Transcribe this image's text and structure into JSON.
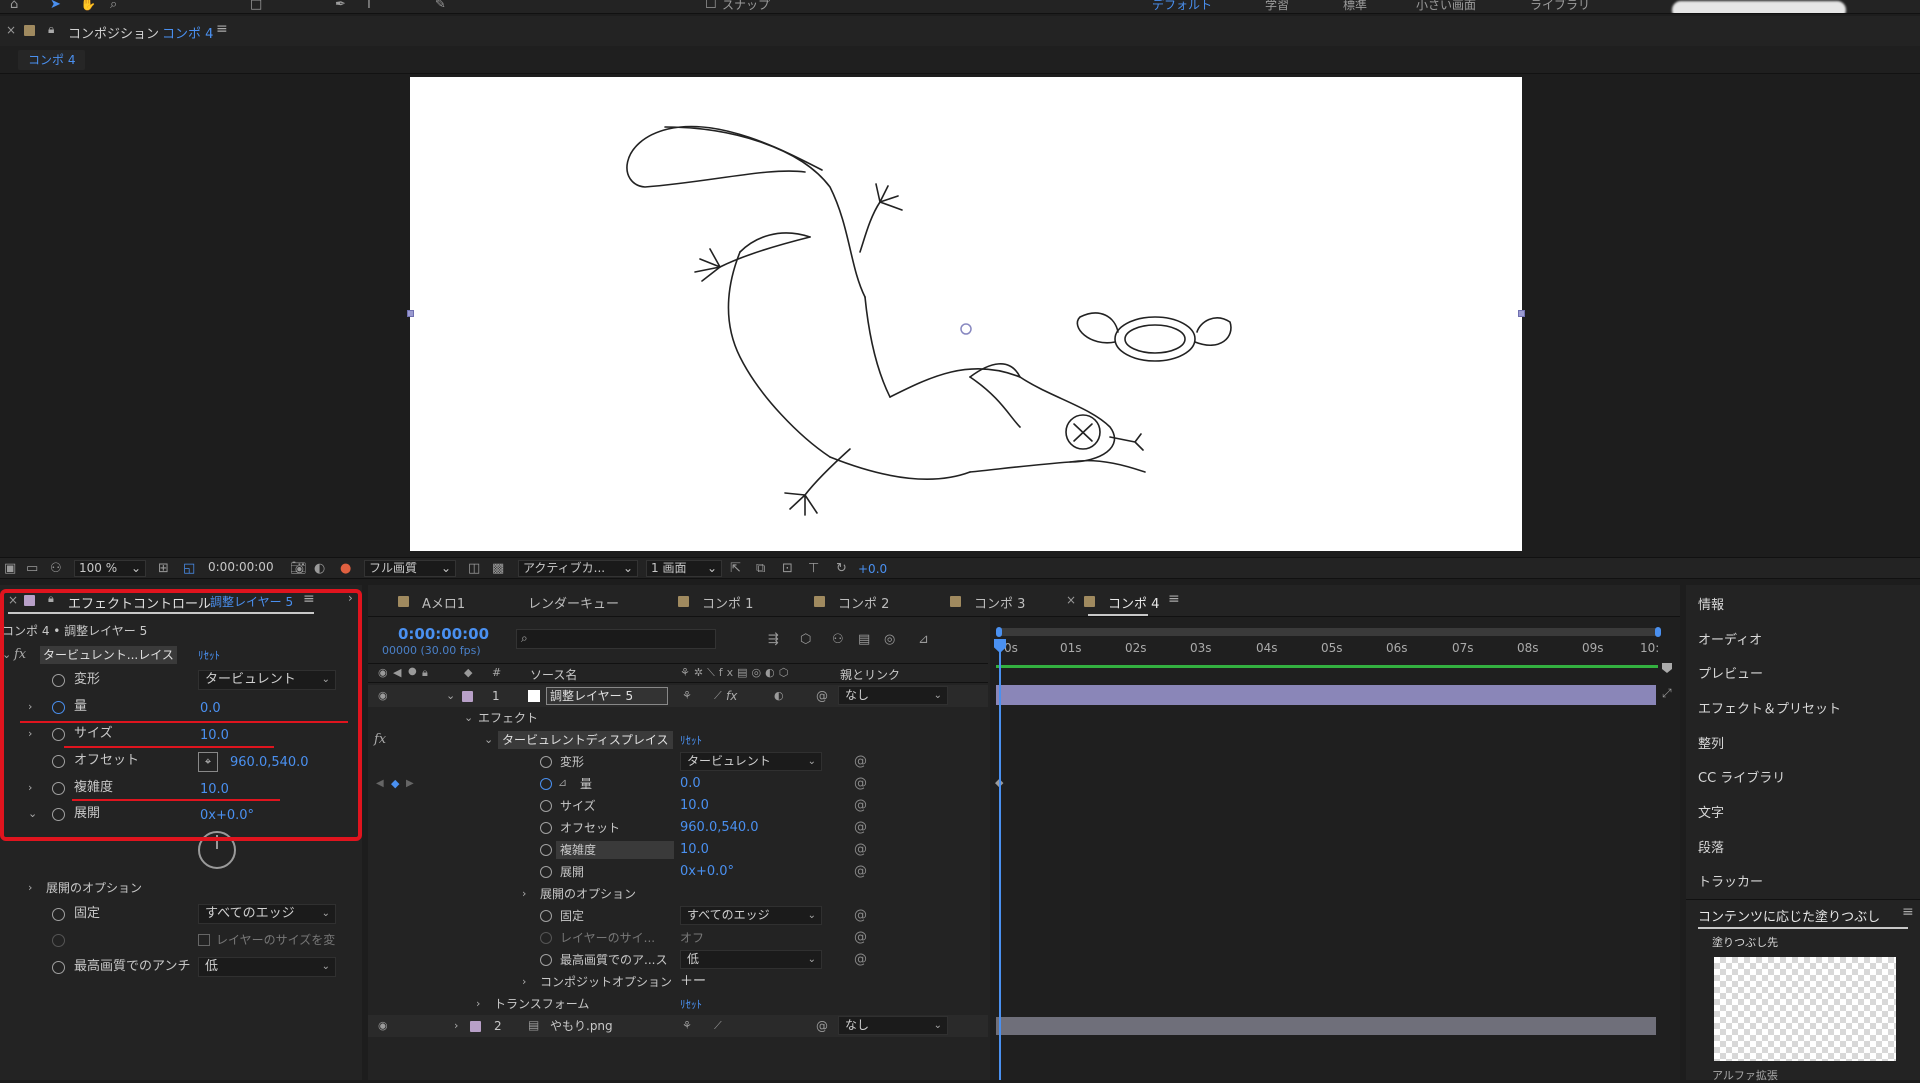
{
  "topbar": {
    "snap_label": "スナップ",
    "workspaces": [
      "デフォルト",
      "学習",
      "標準",
      "小さい画面",
      "ライブラリ"
    ],
    "active_workspace": "デフォルト"
  },
  "comp_panel": {
    "title": "コンポジション",
    "comp_name": "コンポ 4",
    "tab_label": "コンポ 4"
  },
  "viewer_toolbar": {
    "zoom": "100 %",
    "timecode": "0:00:00:00",
    "quality": "フル画質",
    "camera": "アクティブカ...",
    "views": "1 画面",
    "exposure": "+0.0"
  },
  "effect_controls": {
    "panel_title": "エフェクトコントロール",
    "layer_name": "調整レイヤー 5",
    "breadcrumb": "コンポ 4 • 調整レイヤー 5",
    "fx_label": "fx",
    "effect_name": "タービュレント...レイス",
    "reset_label": "ﾘｾｯﾄ",
    "props": {
      "displacement_label": "変形",
      "displacement_value": "タービュレント",
      "amount_label": "量",
      "amount_value": "0.0",
      "size_label": "サイズ",
      "size_value": "10.0",
      "offset_label": "オフセット",
      "offset_value": "960.0,540.0",
      "complexity_label": "複雑度",
      "complexity_value": "10.0",
      "evolution_label": "展開",
      "evolution_value": "0x+0.0°",
      "evolution_options_label": "展開のオプション",
      "pinning_label": "固定",
      "pinning_value": "すべてのエッジ",
      "resize_label": "レイヤーのサイズを変",
      "antialias_label": "最高画質でのアンチ",
      "antialias_value": "低"
    }
  },
  "timeline": {
    "tabs": [
      "Aメロ1",
      "レンダーキュー",
      "コンポ 1",
      "コンポ 2",
      "コンポ 3",
      "コンポ 4"
    ],
    "active_tab": "コンポ 4",
    "timecode": "0:00:00:00",
    "frames": "00000 (30.00 fps)",
    "search_placeholder": "",
    "col_source": "ソース名",
    "col_parent": "親とリンク",
    "ruler": [
      "0s",
      "01s",
      "02s",
      "03s",
      "04s",
      "05s",
      "06s",
      "07s",
      "08s",
      "09s",
      "10:"
    ],
    "layer1": {
      "index": "1",
      "name": "調整レイヤー 5",
      "parent": "なし"
    },
    "effects_group": "エフェクト",
    "effect_name": "タービュレントディスプレイス",
    "reset_label": "ﾘｾｯﾄ",
    "props": {
      "displacement_label": "変形",
      "displacement_value": "タービュレント",
      "amount_label": "量",
      "amount_value": "0.0",
      "size_label": "サイズ",
      "size_value": "10.0",
      "offset_label": "オフセット",
      "offset_value": "960.0,540.0",
      "complexity_label": "複雑度",
      "complexity_value": "10.0",
      "evolution_label": "展開",
      "evolution_value": "0x+0.0°",
      "evolution_options_label": "展開のオプション",
      "pinning_label": "固定",
      "pinning_value": "すべてのエッジ",
      "resize_label": "レイヤーのサイ...",
      "resize_value": "オフ",
      "antialias_label": "最高画質でのア...ス",
      "antialias_value": "低"
    },
    "composite_label": "コンポジットオプション",
    "composite_value": "＋ー",
    "transform_label": "トランスフォーム",
    "transform_reset": "ﾘｾｯﾄ",
    "layer2": {
      "index": "2",
      "name": "やもり.png",
      "parent": "なし"
    }
  },
  "right_panels": {
    "items": [
      "情報",
      "オーディオ",
      "プレビュー",
      "エフェクト＆プリセット",
      "整列",
      "CC ライブラリ",
      "文字",
      "段落",
      "トラッカー"
    ],
    "content_aware_title": "コンテンツに応じた塗りつぶし",
    "fill_target": "塗りつぶし先",
    "alpha_label": "アルファ拡張"
  },
  "colors": {
    "accent": "#4a90f0",
    "highlight_red": "#e0141e",
    "panel_bg": "#232323"
  }
}
